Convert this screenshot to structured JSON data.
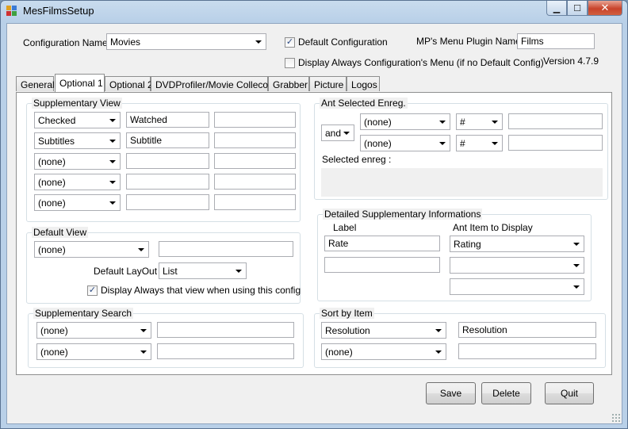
{
  "window": {
    "title": "MesFilmsSetup",
    "min_glyph": "▁",
    "max_glyph": "☐",
    "close_glyph": "✕"
  },
  "header": {
    "config_name_label": "Configuration Name",
    "config_name_value": "Movies",
    "default_config_label": "Default Configuration",
    "default_config_checked": true,
    "display_always_label": "Display Always Configuration's Menu (if no Default Config)",
    "display_always_checked": false,
    "plugin_name_label": "MP's Menu Plugin Name",
    "plugin_name_value": "Films",
    "version": "Version 4.7.9"
  },
  "tabs": [
    {
      "label": "General"
    },
    {
      "label": "Optional 1"
    },
    {
      "label": "Optional 2"
    },
    {
      "label": "DVDProfiler/Movie Collecor"
    },
    {
      "label": "Grabber"
    },
    {
      "label": "Picture"
    },
    {
      "label": "Logos"
    }
  ],
  "supplementary_view": {
    "title": "Supplementary View",
    "rows": [
      {
        "field": "Checked",
        "label": "Watched",
        "value": ""
      },
      {
        "field": "Subtitles",
        "label": "Subtitle",
        "value": ""
      },
      {
        "field": "(none)",
        "label": "",
        "value": ""
      },
      {
        "field": "(none)",
        "label": "",
        "value": ""
      },
      {
        "field": "(none)",
        "label": "",
        "value": ""
      }
    ]
  },
  "ant_selected": {
    "title": "Ant Selected Enreg.",
    "logic": "and",
    "rows": [
      {
        "field": "(none)",
        "op": "#",
        "value": ""
      },
      {
        "field": "(none)",
        "op": "#",
        "value": ""
      }
    ],
    "selected_label": "Selected enreg :"
  },
  "default_view": {
    "title": "Default View",
    "view": "(none)",
    "view_value": "",
    "layout_label": "Default LayOut",
    "layout_value": "List",
    "display_always_label": "Display Always that view when using  this config",
    "display_always_checked": true
  },
  "detailed_info": {
    "title": "Detailed Supplementary Informations",
    "label_header": "Label",
    "item_header": "Ant Item to Display",
    "rows": [
      {
        "label": "Rate",
        "item": "Rating"
      },
      {
        "label": "",
        "item": ""
      },
      {
        "item": ""
      }
    ]
  },
  "supplementary_search": {
    "title": "Supplementary Search",
    "rows": [
      {
        "field": "(none)",
        "value": ""
      },
      {
        "field": "(none)",
        "value": ""
      }
    ]
  },
  "sort_by": {
    "title": "Sort by Item",
    "rows": [
      {
        "field": "Resolution",
        "label": "Resolution"
      },
      {
        "field": "(none)",
        "label": ""
      }
    ]
  },
  "buttons": {
    "save": "Save",
    "delete": "Delete",
    "quit": "Quit"
  },
  "check_glyph": "✓"
}
